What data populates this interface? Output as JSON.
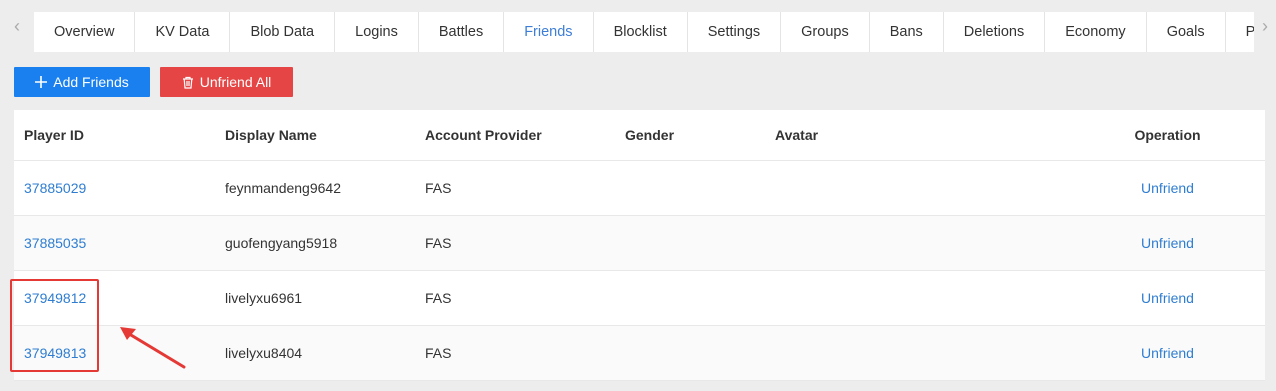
{
  "tabs": [
    {
      "label": "Overview"
    },
    {
      "label": "KV Data"
    },
    {
      "label": "Blob Data"
    },
    {
      "label": "Logins"
    },
    {
      "label": "Battles"
    },
    {
      "label": "Friends"
    },
    {
      "label": "Blocklist"
    },
    {
      "label": "Settings"
    },
    {
      "label": "Groups"
    },
    {
      "label": "Bans"
    },
    {
      "label": "Deletions"
    },
    {
      "label": "Economy"
    },
    {
      "label": "Goals"
    },
    {
      "label": "P"
    }
  ],
  "active_tab": "Friends",
  "toolbar": {
    "add_label": "Add Friends",
    "unfriend_all_label": "Unfriend All"
  },
  "table": {
    "headers": {
      "player_id": "Player ID",
      "display_name": "Display Name",
      "account_provider": "Account Provider",
      "gender": "Gender",
      "avatar": "Avatar",
      "operation": "Operation"
    },
    "rows": [
      {
        "player_id": "37885029",
        "display_name": "feynmandeng9642",
        "account_provider": "FAS",
        "gender": "",
        "avatar": "",
        "operation": "Unfriend"
      },
      {
        "player_id": "37885035",
        "display_name": "guofengyang5918",
        "account_provider": "FAS",
        "gender": "",
        "avatar": "",
        "operation": "Unfriend"
      },
      {
        "player_id": "37949812",
        "display_name": "livelyxu6961",
        "account_provider": "FAS",
        "gender": "",
        "avatar": "",
        "operation": "Unfriend"
      },
      {
        "player_id": "37949813",
        "display_name": "livelyxu8404",
        "account_provider": "FAS",
        "gender": "",
        "avatar": "",
        "operation": "Unfriend"
      }
    ]
  },
  "colors": {
    "primary": "#1a80f0",
    "danger": "#e64545",
    "link": "#2f7dd1",
    "annotation": "#e53935"
  }
}
